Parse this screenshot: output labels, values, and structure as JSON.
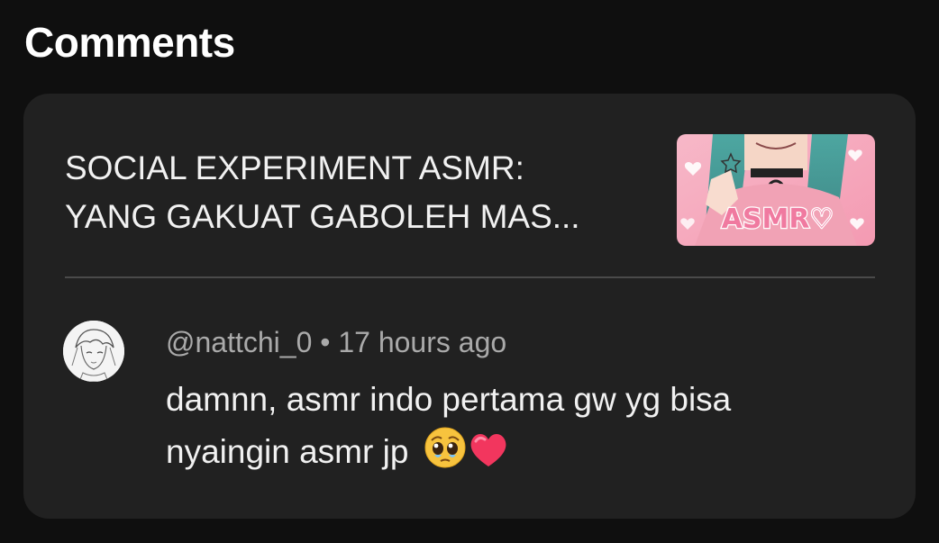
{
  "section": {
    "title": "Comments"
  },
  "video": {
    "title_line1": "SOCIAL EXPERIMENT ASMR:",
    "title_line2": "YANG GAKUAT GABOLEH MAS...",
    "thumbnail_text": "ASMR♡"
  },
  "comment": {
    "author": "@nattchi_0",
    "separator": "•",
    "time": "17 hours ago",
    "text_line1": "damnn, asmr indo pertama gw yg bisa",
    "text_line2": "nyaingin asmr jp",
    "emojis": [
      "pleading-face-emoji",
      "heart-emoji"
    ]
  },
  "colors": {
    "background": "#0f0f0f",
    "card": "#212121",
    "divider": "#4a4a4a",
    "secondary_text": "#aaaaaa",
    "primary_text": "#f1f1f1"
  }
}
